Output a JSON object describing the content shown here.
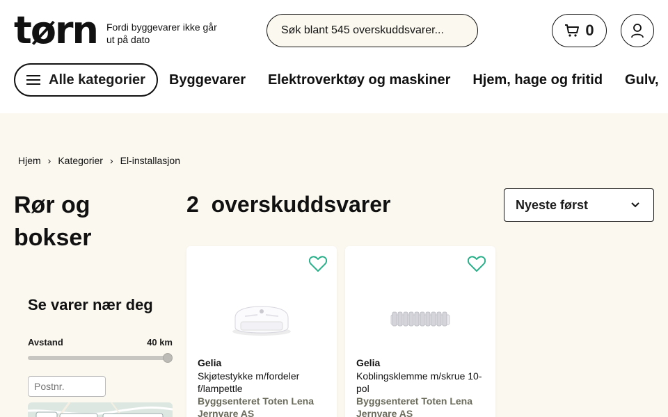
{
  "header": {
    "logo": "tørn",
    "tagline": "Fordi byggevarer ikke går ut på dato",
    "search_placeholder": "Søk blant 545 overskuddsvarer...",
    "cart_count": "0"
  },
  "nav": {
    "all_categories": "Alle kategorier",
    "items": [
      "Byggevarer",
      "Elektroverktøy og maskiner",
      "Hjem, hage og fritid",
      "Gulv, "
    ]
  },
  "breadcrumb": [
    "Hjem",
    "Kategorier",
    "El-installasjon"
  ],
  "category_title": "Rør og bokser",
  "result_count": "2",
  "result_label": "overskuddsvarer",
  "sort": {
    "selected": "Nyeste først"
  },
  "nearby": {
    "title": "Se varer nær deg",
    "distance_label": "Avstand",
    "distance_value": "40 km",
    "distance_fraction": 1.0,
    "postcode_placeholder": "Postnr."
  },
  "products": [
    {
      "brand": "Gelia",
      "name": "Skjøtestykke m/fordeler f/lampettle",
      "store": "Byggsenteret Toten Lena Jernvare AS"
    },
    {
      "brand": "Gelia",
      "name": "Koblingsklemme m/skrue 10-pol",
      "store": "Byggsenteret Toten Lena Jernvare AS"
    }
  ],
  "colors": {
    "background": "#faf8ef",
    "heart": "#2bb08a",
    "store_text": "#6b6b5c"
  }
}
